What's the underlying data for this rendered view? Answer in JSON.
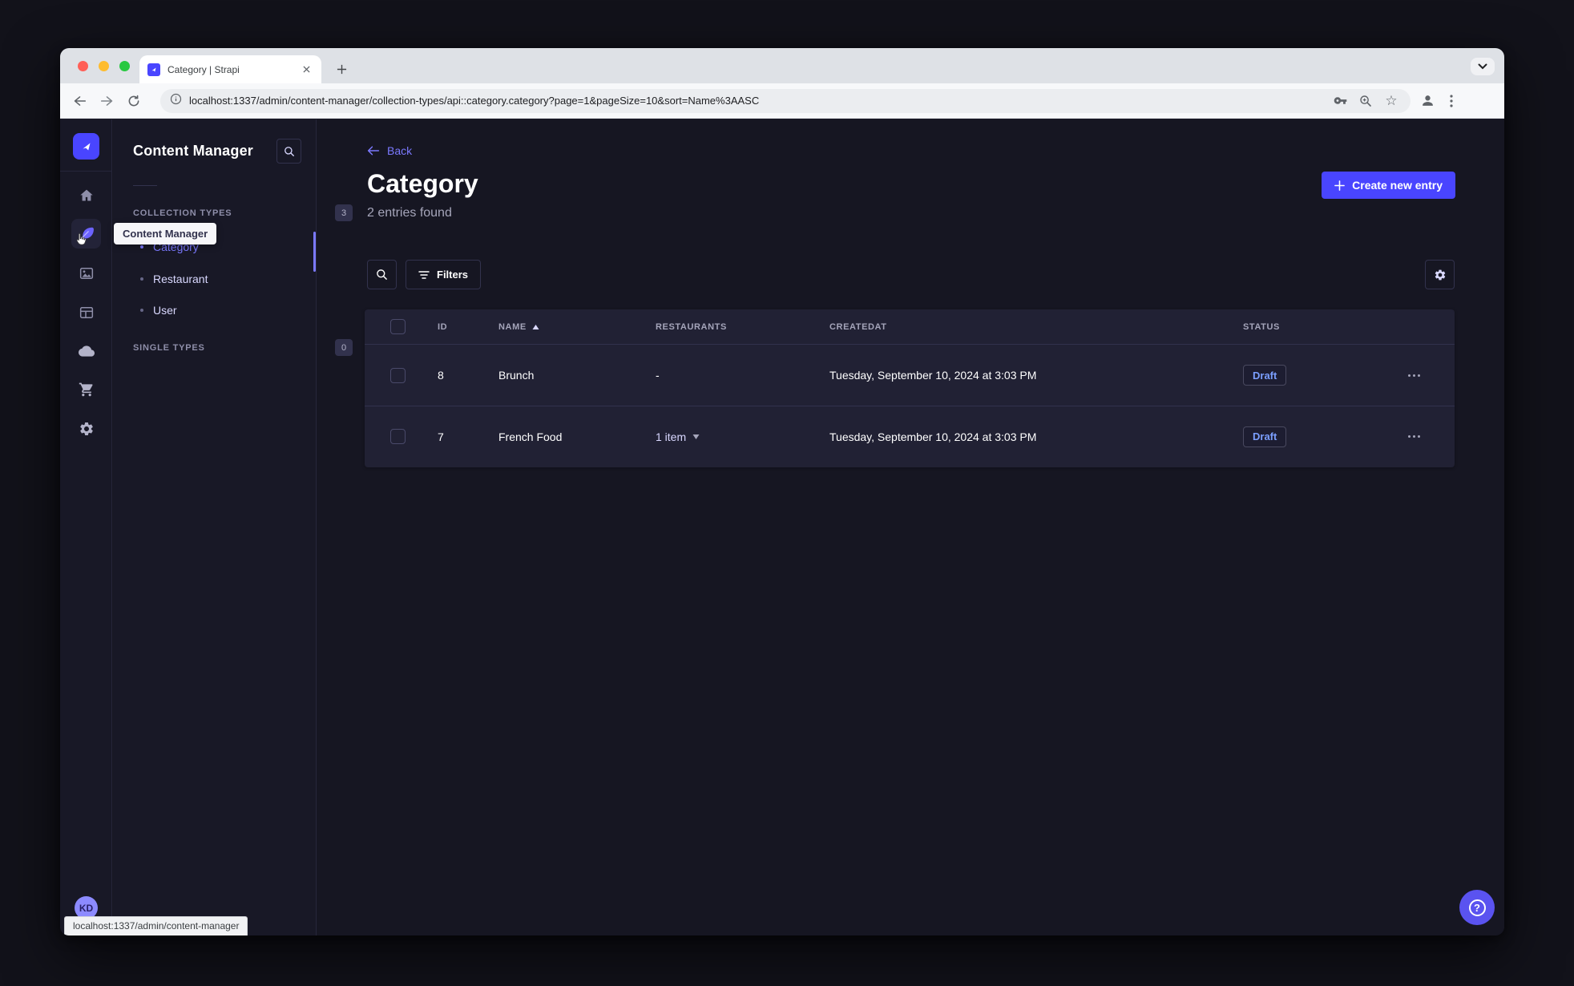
{
  "colors": {
    "primary": "#4945ff",
    "link_purple": "#7b79ff",
    "draft_text": "#7b9fff",
    "card_background": "#212134",
    "app_background": "#181826",
    "traffic_red": "#ff5f57",
    "traffic_yellow": "#febc2e",
    "traffic_green": "#28c840"
  },
  "browser": {
    "tab_title": "Category | Strapi",
    "url": "localhost:1337/admin/content-manager/collection-types/api::category.category?page=1&pageSize=10&sort=Name%3AASC",
    "status_bubble": "localhost:1337/admin/content-manager"
  },
  "rail": {
    "icons": [
      "strapi-logo",
      "home",
      "content-manager",
      "media-library",
      "content-type-builder",
      "cloud",
      "marketplace-cart",
      "settings-gear"
    ],
    "tooltip": "Content Manager",
    "avatar_initials": "KD"
  },
  "subnav": {
    "title": "Content Manager",
    "sections": [
      {
        "label": "COLLECTION TYPES",
        "count": "3",
        "items": [
          {
            "label": "Category"
          },
          {
            "label": "Restaurant"
          },
          {
            "label": "User"
          }
        ]
      },
      {
        "label": "SINGLE TYPES",
        "count": "0",
        "items": []
      }
    ]
  },
  "main": {
    "back_label": "Back",
    "title": "Category",
    "subtitle": "2 entries found",
    "create_button_label": "Create new entry",
    "filters_button_label": "Filters"
  },
  "table": {
    "headers": [
      "ID",
      "NAME",
      "RESTAURANTS",
      "CREATEDAT",
      "STATUS"
    ],
    "rows": [
      {
        "id": "8",
        "name": "Brunch",
        "restaurants": "-",
        "created_at": "Tuesday, September 10, 2024 at 3:03 PM",
        "status": "Draft"
      },
      {
        "id": "7",
        "name": "French Food",
        "restaurants": "1 item",
        "created_at": "Tuesday, September 10, 2024 at 3:03 PM",
        "status": "Draft"
      }
    ]
  },
  "help": {
    "glyph": "?"
  }
}
